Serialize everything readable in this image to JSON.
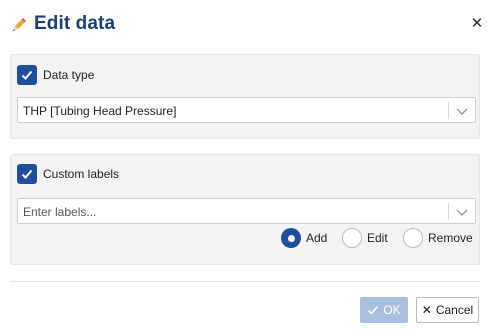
{
  "dialog": {
    "title": "Edit data",
    "icons": {
      "title": "pencil-icon",
      "close": "close-icon"
    },
    "close_glyph": "✕"
  },
  "data_type": {
    "checkbox_label": "Data type",
    "checked": true,
    "select_value": "THP [Tubing Head Pressure]"
  },
  "custom_labels": {
    "checkbox_label": "Custom labels",
    "checked": true,
    "input_placeholder": "Enter labels...",
    "modes": [
      {
        "label": "Add",
        "selected": true
      },
      {
        "label": "Edit",
        "selected": false
      },
      {
        "label": "Remove",
        "selected": false
      }
    ]
  },
  "footer": {
    "ok_label": "OK",
    "ok_enabled": false,
    "cancel_label": "Cancel",
    "cancel_glyph": "✕"
  },
  "colors": {
    "accent": "#1f4e9c",
    "title": "#1f3f7a",
    "ok_disabled": "#a9bfdc",
    "panel_bg": "#f3f3f3"
  }
}
